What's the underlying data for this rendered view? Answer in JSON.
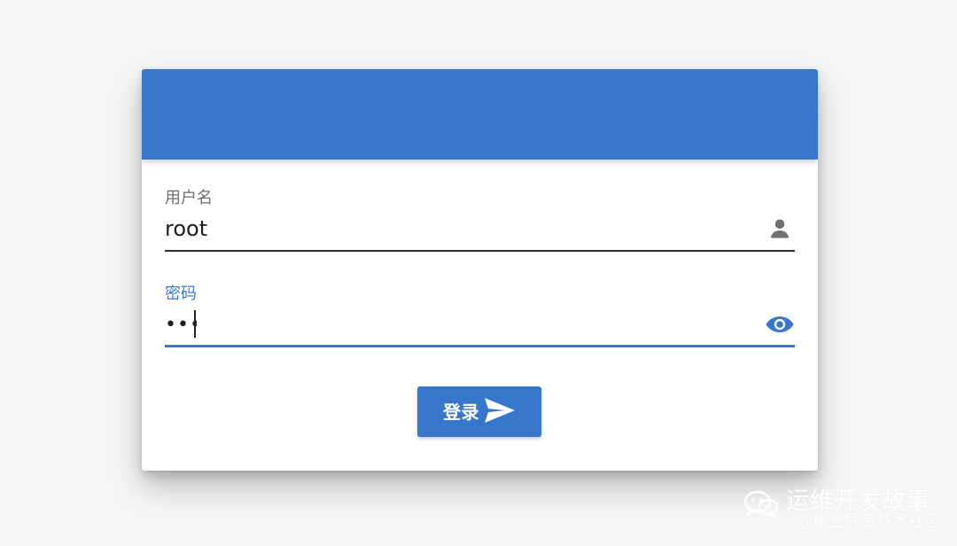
{
  "colors": {
    "background": "#f6f6f7",
    "primary": "#3977cb",
    "card": "#ffffff",
    "text": "#202020",
    "muted_label": "#6e6e6e",
    "icon": "#6f6f6f"
  },
  "login_form": {
    "username": {
      "label": "用户名",
      "value": "root",
      "icon": "person-icon"
    },
    "password": {
      "label": "密码",
      "value": "1234",
      "icon": "eye-icon",
      "focused": true
    },
    "submit": {
      "label": "登录",
      "icon": "send-icon"
    }
  },
  "watermark": {
    "title": "运维开发故事",
    "subtitle": "@稀土掘金技术社区",
    "icon": "wechat-icon"
  }
}
